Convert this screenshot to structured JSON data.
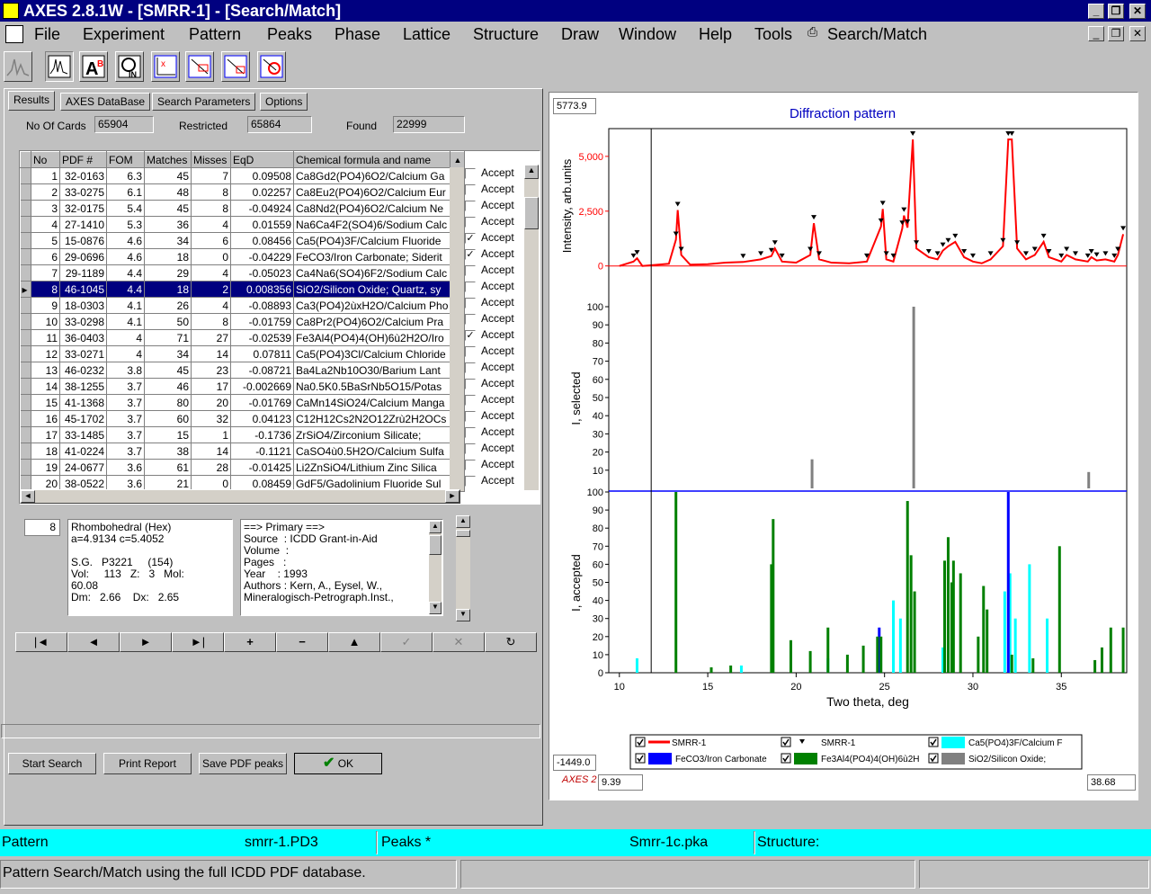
{
  "title": "AXES 2.8.1W - [SMRR-1] - [Search/Match]",
  "menu": [
    "File",
    "Experiment",
    "Pattern",
    "Peaks",
    "Phase",
    "Lattice",
    "Structure",
    "Draw",
    "Window",
    "Help",
    "Tools",
    "Search/Match"
  ],
  "tabs": [
    "Results",
    "AXES DataBase",
    "Search Parameters",
    "Options"
  ],
  "counts": {
    "cards_label": "No Of Cards",
    "cards": "65904",
    "restricted_label": "Restricted",
    "restricted": "65864",
    "found_label": "Found",
    "found": "22999"
  },
  "columns": [
    "No",
    "PDF #",
    "FOM",
    "Matches",
    "Misses",
    "EqD",
    "Chemical formula and name"
  ],
  "rows": [
    [
      "1",
      "32-0163",
      "6.3",
      "45",
      "7",
      "0.09508",
      "Ca8Gd2(PO4)6O2/Calcium Ga"
    ],
    [
      "2",
      "33-0275",
      "6.1",
      "48",
      "8",
      "0.02257",
      "Ca8Eu2(PO4)6O2/Calcium Eur"
    ],
    [
      "3",
      "32-0175",
      "5.4",
      "45",
      "8",
      "-0.04924",
      "Ca8Nd2(PO4)6O2/Calcium Ne"
    ],
    [
      "4",
      "27-1410",
      "5.3",
      "36",
      "4",
      "0.01559",
      "Na6Ca4F2(SO4)6/Sodium Calc"
    ],
    [
      "5",
      "15-0876",
      "4.6",
      "34",
      "6",
      "0.08456",
      "Ca5(PO4)3F/Calcium Fluoride"
    ],
    [
      "6",
      "29-0696",
      "4.6",
      "18",
      "0",
      "-0.04229",
      "FeCO3/Iron Carbonate; Siderit"
    ],
    [
      "7",
      "29-1189",
      "4.4",
      "29",
      "4",
      "-0.05023",
      "Ca4Na6(SO4)6F2/Sodium Calc"
    ],
    [
      "8",
      "46-1045",
      "4.4",
      "18",
      "2",
      "0.008356",
      "SiO2/Silicon Oxide; Quartz, sy"
    ],
    [
      "9",
      "18-0303",
      "4.1",
      "26",
      "4",
      "-0.08893",
      "Ca3(PO4)2ùxH2O/Calcium Pho"
    ],
    [
      "10",
      "33-0298",
      "4.1",
      "50",
      "8",
      "-0.01759",
      "Ca8Pr2(PO4)6O2/Calcium Pra"
    ],
    [
      "11",
      "36-0403",
      "4",
      "71",
      "27",
      "-0.02539",
      "Fe3Al4(PO4)4(OH)6ù2H2O/Iro"
    ],
    [
      "12",
      "33-0271",
      "4",
      "34",
      "14",
      "0.07811",
      "Ca5(PO4)3Cl/Calcium Chloride"
    ],
    [
      "13",
      "46-0232",
      "3.8",
      "45",
      "23",
      "-0.08721",
      "Ba4La2Nb10O30/Barium Lant"
    ],
    [
      "14",
      "38-1255",
      "3.7",
      "46",
      "17",
      "-0.002669",
      "Na0.5K0.5BaSrNb5O15/Potas"
    ],
    [
      "15",
      "41-1368",
      "3.7",
      "80",
      "20",
      "-0.01769",
      "CaMn14SiO24/Calcium Manga"
    ],
    [
      "16",
      "45-1702",
      "3.7",
      "60",
      "32",
      "0.04123",
      "C12H12Cs2N2O12Zrù2H2OCs"
    ],
    [
      "17",
      "33-1485",
      "3.7",
      "15",
      "1",
      "-0.1736",
      "ZrSiO4/Zirconium Silicate;"
    ],
    [
      "18",
      "41-0224",
      "3.7",
      "38",
      "14",
      "-0.1121",
      "CaSO4ù0.5H2O/Calcium Sulfa"
    ],
    [
      "19",
      "24-0677",
      "3.6",
      "61",
      "28",
      "-0.01425",
      "Li2ZnSiO4/Lithium Zinc Silica"
    ],
    [
      "20",
      "38-0522",
      "3.6",
      "21",
      "0",
      "0.08459",
      "GdF5/Gadolinium Fluoride Sul"
    ]
  ],
  "accept_label": "Accept",
  "accepted": [
    false,
    false,
    false,
    false,
    true,
    true,
    false,
    false,
    false,
    false,
    true,
    false,
    false,
    false,
    false,
    false,
    false,
    false,
    false,
    false
  ],
  "selected_row": 8,
  "detail": {
    "index": "8",
    "cell": "Rhombohedral (Hex)\na=4.9134 c=5.4052\n\nS.G.   P3221     (154)\nVol:     113   Z:   3   Mol:\n60.08\nDm:   2.66    Dx:   2.65",
    "ref": "==> Primary ==>\nSource  : ICDD Grant-in-Aid\nVolume  :\nPages   :\nYear    : 1993\nAuthors : Kern, A., Eysel, W.,\nMineralogisch-Petrograph.Inst.,"
  },
  "nav": [
    "|◄",
    "◄",
    "►",
    "►|",
    "+",
    "−",
    "▲",
    "✓",
    "✕",
    "↻"
  ],
  "buttons": {
    "start": "Start Search",
    "print": "Print Report",
    "save": "Save PDF peaks",
    "ok": "OK"
  },
  "plot": {
    "title": "Diffraction pattern",
    "ymax_box": "5773.9",
    "ymin_box": "-1449.0",
    "xmin_box": "9.39",
    "xmax_box": "38.68",
    "corner": "AXES 2",
    "xlabel": "Two theta, deg",
    "y1label": "Intensity, arb.units",
    "y2label": "I, selected",
    "y3label": "I, accepted"
  },
  "legend": [
    {
      "name": "SMRR-1",
      "color": "#ff0000",
      "kind": "line"
    },
    {
      "name": "SMRR-1",
      "color": "#000000",
      "kind": "marker"
    },
    {
      "name": "Ca5(PO4)3F/Calcium F",
      "color": "#00ffff",
      "kind": "box"
    },
    {
      "name": "FeCO3/Iron Carbonate",
      "color": "#0000ff",
      "kind": "box"
    },
    {
      "name": "Fe3Al4(PO4)4(OH)6ù2H",
      "color": "#008000",
      "kind": "box"
    },
    {
      "name": "SiO2/Silicon Oxide;",
      "color": "#808080",
      "kind": "box"
    }
  ],
  "chart_data": {
    "type": "bar",
    "title": "Diffraction pattern",
    "xlabel": "Two theta, deg",
    "xlim": [
      9.39,
      38.68
    ],
    "pattern": {
      "name": "SMRR-1",
      "ylabel": "Intensity, arb.units",
      "ylim": [
        -300,
        5773.9
      ],
      "x": [
        10,
        10.8,
        11,
        11.3,
        12.8,
        13.2,
        13.3,
        13.5,
        14,
        15,
        16,
        17,
        18,
        18.6,
        18.8,
        19.2,
        20,
        20.8,
        21,
        21.3,
        22,
        23,
        24,
        24.8,
        24.9,
        25.1,
        25.5,
        26,
        26.1,
        26.3,
        26.6,
        26.8,
        27.5,
        28,
        28.3,
        28.6,
        29,
        29.5,
        30,
        30.5,
        31,
        31.7,
        32,
        32.2,
        32.5,
        33,
        33.5,
        34,
        34.3,
        35,
        35.3,
        35.8,
        36.5,
        36.7,
        37,
        37.5,
        38,
        38.2,
        38.5
      ],
      "y": [
        0,
        200,
        350,
        0,
        100,
        1200,
        2550,
        500,
        60,
        80,
        150,
        180,
        300,
        450,
        800,
        200,
        150,
        500,
        1950,
        300,
        150,
        120,
        200,
        1800,
        2600,
        300,
        200,
        1700,
        2300,
        1750,
        5773.9,
        800,
        400,
        300,
        700,
        900,
        1100,
        400,
        200,
        120,
        300,
        900,
        5773.9,
        5773.9,
        800,
        300,
        500,
        1100,
        400,
        200,
        500,
        300,
        200,
        400,
        250,
        300,
        200,
        500,
        1450
      ]
    },
    "selected": {
      "name": "SiO2/Silicon Oxide;",
      "ylabel": "I, selected",
      "ylim": [
        0,
        100
      ],
      "x": [
        20.9,
        26.65,
        36.55
      ],
      "y": [
        16,
        100,
        9
      ]
    },
    "accepted": {
      "ylabel": "I, accepted",
      "ylim": [
        0,
        100
      ],
      "series": [
        {
          "name": "Ca5(PO4)3F/Calcium F",
          "x": [
            11,
            16.9,
            21.8,
            25.5,
            25.9,
            28.3,
            31.8,
            32.1,
            32.4,
            33.2,
            34.2
          ],
          "y": [
            8,
            4,
            8,
            40,
            30,
            14,
            45,
            55,
            30,
            60,
            30
          ]
        },
        {
          "name": "FeCO3/Iron Carbonate",
          "x": [
            24.7,
            32
          ],
          "y": [
            25,
            100
          ]
        },
        {
          "name": "Fe3Al4(PO4)4(OH)6ù2H",
          "x": [
            13.2,
            15.2,
            16.3,
            18.6,
            18.7,
            19.7,
            20.8,
            21.8,
            22.9,
            23.8,
            24.6,
            24.8,
            26.3,
            26.5,
            26.7,
            28.4,
            28.6,
            28.8,
            28.9,
            29.3,
            30.3,
            30.6,
            30.8,
            32.2,
            33.4,
            34.9,
            36.9,
            37.3,
            37.8,
            38.5
          ],
          "y": [
            100,
            3,
            4,
            60,
            85,
            18,
            12,
            25,
            10,
            15,
            20,
            20,
            95,
            65,
            45,
            62,
            75,
            50,
            62,
            55,
            20,
            48,
            35,
            10,
            8,
            70,
            7,
            14,
            25,
            25
          ]
        }
      ]
    }
  },
  "status": {
    "pattern_label": "Pattern",
    "pattern_file": "smrr-1.PD3",
    "peaks_label": "Peaks  *",
    "peaks_file": "Smrr-1c.pka",
    "structure_label": "Structure:",
    "message": "Pattern Search/Match using the full ICDD PDF database."
  }
}
